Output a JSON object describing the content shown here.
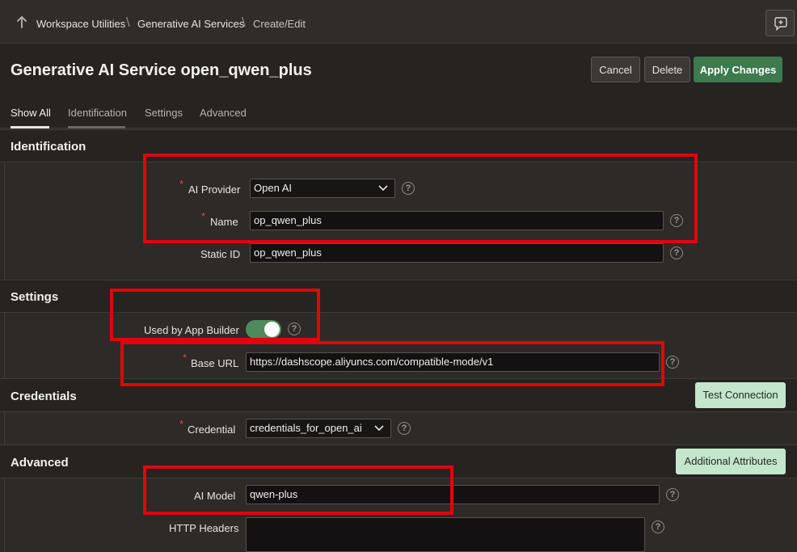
{
  "breadcrumb": {
    "up_icon": "arrow-up-icon",
    "items": [
      "Workspace Utilities",
      "Generative AI Services",
      "Create/Edit"
    ],
    "separator": "\\"
  },
  "header": {
    "title": "Generative AI Service open_qwen_plus",
    "help_icon": "chat-help-icon",
    "buttons": {
      "cancel": "Cancel",
      "delete": "Delete",
      "apply": "Apply Changes"
    }
  },
  "tabs": [
    {
      "label": "Show All",
      "active": true
    },
    {
      "label": "Identification",
      "active": false
    },
    {
      "label": "Settings",
      "active": false
    },
    {
      "label": "Advanced",
      "active": false
    }
  ],
  "identification": {
    "title": "Identification",
    "ai_provider_label": "AI Provider",
    "ai_provider_value": "Open AI",
    "name_label": "Name",
    "name_value": "op_qwen_plus",
    "static_id_label": "Static ID",
    "static_id_value": "op_qwen_plus"
  },
  "settings": {
    "title": "Settings",
    "used_by_app_builder_label": "Used by App Builder",
    "used_by_app_builder_on": true,
    "base_url_label": "Base URL",
    "base_url_value": "https://dashscope.aliyuncs.com/compatible-mode/v1"
  },
  "credentials": {
    "title": "Credentials",
    "test_connection_label": "Test Connection",
    "credential_label": "Credential",
    "credential_value": "credentials_for_open_ai"
  },
  "advanced": {
    "title": "Advanced",
    "additional_attributes_label": "Additional Attributes",
    "ai_model_label": "AI Model",
    "ai_model_value": "qwen-plus",
    "http_headers_label": "HTTP Headers"
  },
  "colors": {
    "accent_green": "#3d7a4e",
    "light_green_button": "#c3e6cd",
    "required_marker": "#e5433a",
    "highlight_box": "#e0060a"
  },
  "help_glyph": "?"
}
